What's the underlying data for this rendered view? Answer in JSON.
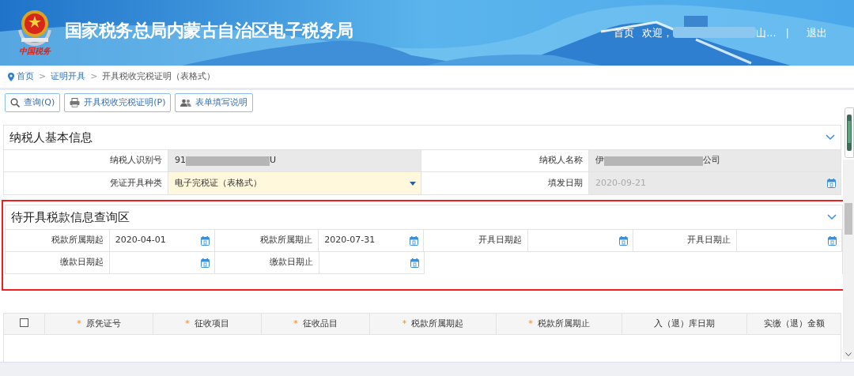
{
  "header": {
    "logo_text": "中国税务",
    "title": "国家税务总局内蒙古自治区电子税务局",
    "nav": [
      {
        "kind": "link",
        "text": "首页"
      },
      {
        "kind": "text",
        "text": "欢迎，"
      },
      {
        "kind": "redacted"
      },
      {
        "kind": "text",
        "text": "山..."
      },
      {
        "kind": "separator",
        "text": "|"
      },
      {
        "kind": "link",
        "text": "退出"
      }
    ]
  },
  "breadcrumb": [
    {
      "text": "首页",
      "kind": "link"
    },
    {
      "text": ">",
      "kind": "separator"
    },
    {
      "text": "证明开具",
      "kind": "link"
    },
    {
      "text": ">",
      "kind": "separator"
    },
    {
      "text": "开具税收完税证明（表格式）",
      "kind": "current"
    }
  ],
  "toolbar": [
    {
      "label": "查询(Q)"
    },
    {
      "label": "开具税收完税证明(P)"
    },
    {
      "label": "表单填写说明"
    }
  ],
  "basic_panel": {
    "title": "纳税人基本信息",
    "expanded": true,
    "rows": [
      [
        {
          "label": "纳税人识别号",
          "kind": "text",
          "disabled": true,
          "value_parts": [
            "91",
            "U"
          ]
        },
        {
          "label": "纳税人名称",
          "kind": "text",
          "disabled": true,
          "value_parts": [
            "伊",
            "公司"
          ]
        }
      ],
      [
        {
          "label": "凭证开具种类",
          "kind": "select",
          "disabled": false,
          "value_parts": [
            "电子完税证（表格式）"
          ]
        },
        {
          "label": "填发日期",
          "kind": "date",
          "disabled": true,
          "value_parts": [
            "2020-09-21"
          ]
        }
      ]
    ]
  },
  "query_panel": {
    "title": "待开具税款信息查询区",
    "expanded": true,
    "highlighted": true,
    "rows": [
      [
        {
          "label": "税款所属期起",
          "value": "2020-04-01"
        },
        {
          "label": "税款所属期止",
          "value": "2020-07-31"
        },
        {
          "label": "开具日期起"
        },
        {
          "label": "开具日期止"
        }
      ],
      [
        {
          "label": "缴款日期起"
        },
        {
          "label": "缴款日期止"
        }
      ]
    ]
  },
  "table": {
    "select_all": {
      "checked": false
    },
    "columns": [
      {
        "label": "原凭证号",
        "required_mark": "*"
      },
      {
        "label": "征收项目",
        "required_mark": "*"
      },
      {
        "label": "征收品目",
        "required_mark": "*"
      },
      {
        "label": "税款所属期起",
        "required_mark": "*"
      },
      {
        "label": "税款所属期止",
        "required_mark": "*"
      },
      {
        "label": "入（退）库日期"
      },
      {
        "label": "实缴（退）金额"
      }
    ]
  }
}
